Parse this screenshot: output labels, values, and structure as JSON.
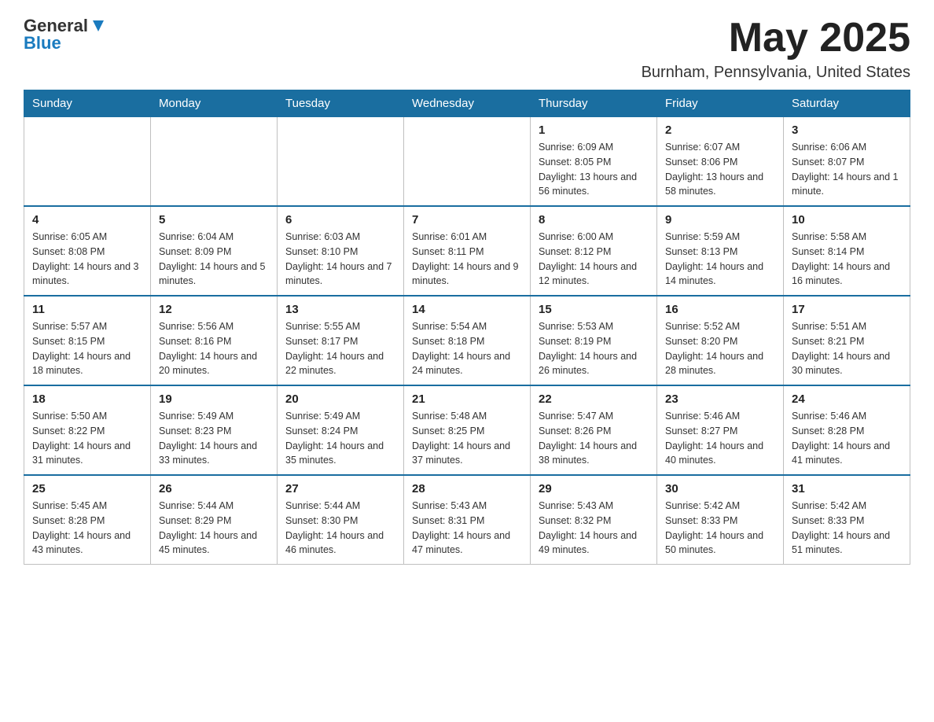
{
  "header": {
    "logo_text_main": "General",
    "logo_text_accent": "Blue",
    "month_title": "May 2025",
    "location": "Burnham, Pennsylvania, United States"
  },
  "days_of_week": [
    "Sunday",
    "Monday",
    "Tuesday",
    "Wednesday",
    "Thursday",
    "Friday",
    "Saturday"
  ],
  "weeks": [
    [
      {
        "day": "",
        "info": ""
      },
      {
        "day": "",
        "info": ""
      },
      {
        "day": "",
        "info": ""
      },
      {
        "day": "",
        "info": ""
      },
      {
        "day": "1",
        "info": "Sunrise: 6:09 AM\nSunset: 8:05 PM\nDaylight: 13 hours and 56 minutes."
      },
      {
        "day": "2",
        "info": "Sunrise: 6:07 AM\nSunset: 8:06 PM\nDaylight: 13 hours and 58 minutes."
      },
      {
        "day": "3",
        "info": "Sunrise: 6:06 AM\nSunset: 8:07 PM\nDaylight: 14 hours and 1 minute."
      }
    ],
    [
      {
        "day": "4",
        "info": "Sunrise: 6:05 AM\nSunset: 8:08 PM\nDaylight: 14 hours and 3 minutes."
      },
      {
        "day": "5",
        "info": "Sunrise: 6:04 AM\nSunset: 8:09 PM\nDaylight: 14 hours and 5 minutes."
      },
      {
        "day": "6",
        "info": "Sunrise: 6:03 AM\nSunset: 8:10 PM\nDaylight: 14 hours and 7 minutes."
      },
      {
        "day": "7",
        "info": "Sunrise: 6:01 AM\nSunset: 8:11 PM\nDaylight: 14 hours and 9 minutes."
      },
      {
        "day": "8",
        "info": "Sunrise: 6:00 AM\nSunset: 8:12 PM\nDaylight: 14 hours and 12 minutes."
      },
      {
        "day": "9",
        "info": "Sunrise: 5:59 AM\nSunset: 8:13 PM\nDaylight: 14 hours and 14 minutes."
      },
      {
        "day": "10",
        "info": "Sunrise: 5:58 AM\nSunset: 8:14 PM\nDaylight: 14 hours and 16 minutes."
      }
    ],
    [
      {
        "day": "11",
        "info": "Sunrise: 5:57 AM\nSunset: 8:15 PM\nDaylight: 14 hours and 18 minutes."
      },
      {
        "day": "12",
        "info": "Sunrise: 5:56 AM\nSunset: 8:16 PM\nDaylight: 14 hours and 20 minutes."
      },
      {
        "day": "13",
        "info": "Sunrise: 5:55 AM\nSunset: 8:17 PM\nDaylight: 14 hours and 22 minutes."
      },
      {
        "day": "14",
        "info": "Sunrise: 5:54 AM\nSunset: 8:18 PM\nDaylight: 14 hours and 24 minutes."
      },
      {
        "day": "15",
        "info": "Sunrise: 5:53 AM\nSunset: 8:19 PM\nDaylight: 14 hours and 26 minutes."
      },
      {
        "day": "16",
        "info": "Sunrise: 5:52 AM\nSunset: 8:20 PM\nDaylight: 14 hours and 28 minutes."
      },
      {
        "day": "17",
        "info": "Sunrise: 5:51 AM\nSunset: 8:21 PM\nDaylight: 14 hours and 30 minutes."
      }
    ],
    [
      {
        "day": "18",
        "info": "Sunrise: 5:50 AM\nSunset: 8:22 PM\nDaylight: 14 hours and 31 minutes."
      },
      {
        "day": "19",
        "info": "Sunrise: 5:49 AM\nSunset: 8:23 PM\nDaylight: 14 hours and 33 minutes."
      },
      {
        "day": "20",
        "info": "Sunrise: 5:49 AM\nSunset: 8:24 PM\nDaylight: 14 hours and 35 minutes."
      },
      {
        "day": "21",
        "info": "Sunrise: 5:48 AM\nSunset: 8:25 PM\nDaylight: 14 hours and 37 minutes."
      },
      {
        "day": "22",
        "info": "Sunrise: 5:47 AM\nSunset: 8:26 PM\nDaylight: 14 hours and 38 minutes."
      },
      {
        "day": "23",
        "info": "Sunrise: 5:46 AM\nSunset: 8:27 PM\nDaylight: 14 hours and 40 minutes."
      },
      {
        "day": "24",
        "info": "Sunrise: 5:46 AM\nSunset: 8:28 PM\nDaylight: 14 hours and 41 minutes."
      }
    ],
    [
      {
        "day": "25",
        "info": "Sunrise: 5:45 AM\nSunset: 8:28 PM\nDaylight: 14 hours and 43 minutes."
      },
      {
        "day": "26",
        "info": "Sunrise: 5:44 AM\nSunset: 8:29 PM\nDaylight: 14 hours and 45 minutes."
      },
      {
        "day": "27",
        "info": "Sunrise: 5:44 AM\nSunset: 8:30 PM\nDaylight: 14 hours and 46 minutes."
      },
      {
        "day": "28",
        "info": "Sunrise: 5:43 AM\nSunset: 8:31 PM\nDaylight: 14 hours and 47 minutes."
      },
      {
        "day": "29",
        "info": "Sunrise: 5:43 AM\nSunset: 8:32 PM\nDaylight: 14 hours and 49 minutes."
      },
      {
        "day": "30",
        "info": "Sunrise: 5:42 AM\nSunset: 8:33 PM\nDaylight: 14 hours and 50 minutes."
      },
      {
        "day": "31",
        "info": "Sunrise: 5:42 AM\nSunset: 8:33 PM\nDaylight: 14 hours and 51 minutes."
      }
    ]
  ]
}
